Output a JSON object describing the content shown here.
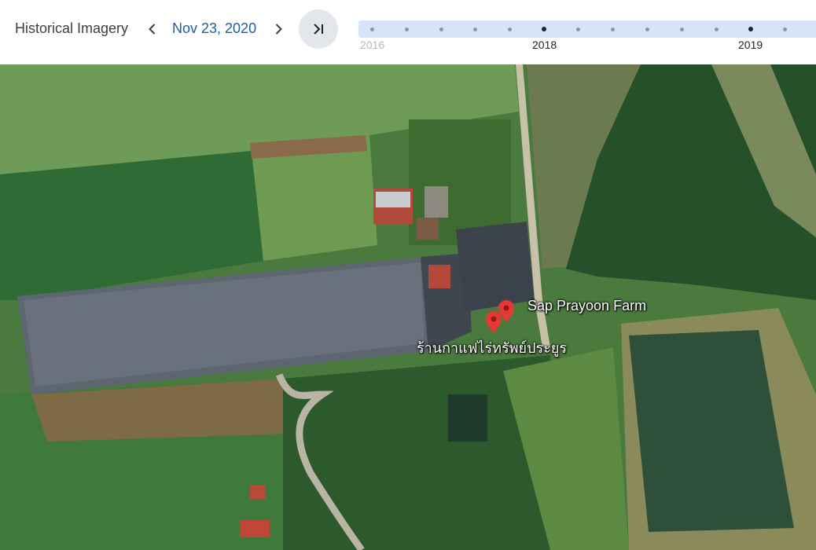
{
  "toolbar": {
    "title": "Historical Imagery",
    "date": "Nov 23, 2020",
    "prev_icon": "chevron-left-icon",
    "next_icon": "chevron-right-icon",
    "latest_icon": "skip-to-end-icon"
  },
  "timeline": {
    "years": [
      {
        "label": "2016",
        "faded": true
      },
      {
        "label": "2018",
        "faded": false
      },
      {
        "label": "2019",
        "faded": false
      }
    ]
  },
  "map": {
    "places": [
      {
        "name": "Sap Prayoon Farm"
      },
      {
        "name": "ร้านกาแฟไร่ทรัพย์ประยูร"
      }
    ],
    "pin_color": "#e53935"
  },
  "colors": {
    "accent": "#1a5fa8",
    "timeline_bg": "#d6e3fa"
  }
}
